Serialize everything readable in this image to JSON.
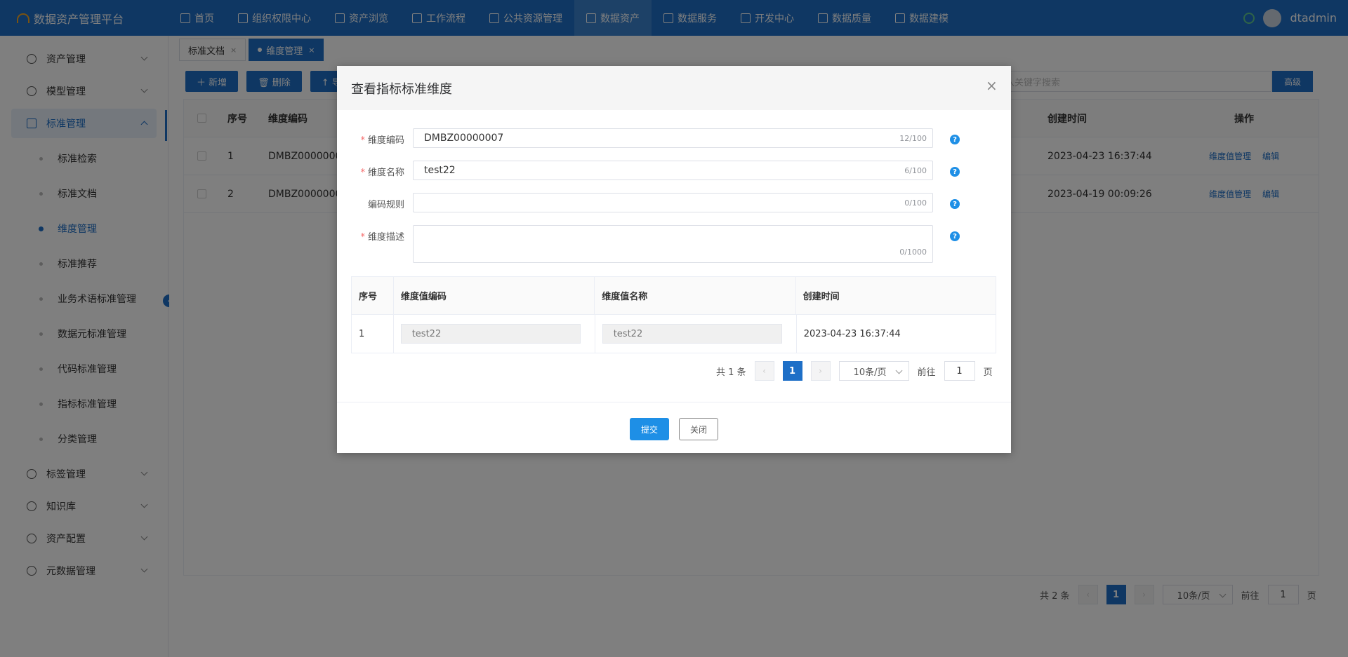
{
  "app": {
    "title": "数据资产管理平台"
  },
  "topnav": {
    "items": [
      {
        "label": "首页",
        "icon": "home-icon"
      },
      {
        "label": "组织权限中心",
        "icon": "shield-icon"
      },
      {
        "label": "资产浏览",
        "icon": "list-icon"
      },
      {
        "label": "工作流程",
        "icon": "workflow-icon"
      },
      {
        "label": "公共资源管理",
        "icon": "resource-icon"
      },
      {
        "label": "数据资产",
        "icon": "asset-icon"
      },
      {
        "label": "数据服务",
        "icon": "service-icon"
      },
      {
        "label": "开发中心",
        "icon": "edit-icon"
      },
      {
        "label": "数据质量",
        "icon": "chart-icon"
      },
      {
        "label": "数据建模",
        "icon": "layers-icon"
      }
    ],
    "active_index": 5,
    "user": "dtadmin"
  },
  "sidebar": {
    "groups_top": [
      {
        "label": "资产管理",
        "icon": "clock-icon"
      },
      {
        "label": "模型管理",
        "icon": "model-icon"
      },
      {
        "label": "标准管理",
        "icon": "document-icon"
      }
    ],
    "sub_items": [
      {
        "label": "标准检索"
      },
      {
        "label": "标准文档"
      },
      {
        "label": "维度管理"
      },
      {
        "label": "标准推荐"
      },
      {
        "label": "业务术语标准管理"
      },
      {
        "label": "数据元标准管理"
      },
      {
        "label": "代码标准管理"
      },
      {
        "label": "指标标准管理"
      },
      {
        "label": "分类管理"
      }
    ],
    "active_sub": 2,
    "groups_bottom": [
      {
        "label": "标签管理",
        "icon": "plus-circle-icon"
      },
      {
        "label": "知识库",
        "icon": "tag-icon"
      },
      {
        "label": "资产配置",
        "icon": "settings-icon"
      },
      {
        "label": "元数据管理",
        "icon": "database-icon"
      }
    ]
  },
  "tabs": [
    {
      "label": "标准文档",
      "active": false
    },
    {
      "label": "维度管理",
      "active": true
    }
  ],
  "toolbar": {
    "add": "＋ 新增",
    "delete": "🗑 删除",
    "import": "↑ 导"
  },
  "search": {
    "placeholder": "入关键字搜索",
    "advanced": "高级"
  },
  "table": {
    "headers": {
      "idx": "序号",
      "code": "维度编码",
      "time": "创建时间",
      "ops": "操作"
    },
    "rows": [
      {
        "idx": "1",
        "code": "DMBZ0000000",
        "time": "2023-04-23 16:37:44",
        "op1": "维度值管理",
        "op2": "编辑"
      },
      {
        "idx": "2",
        "code": "DMBZ0000000",
        "time": "2023-04-19 00:09:26",
        "op1": "维度值管理",
        "op2": "编辑"
      }
    ]
  },
  "pager": {
    "total": "共 2 条",
    "page": "1",
    "size": "10条/页",
    "goto": "前往",
    "goto_value": "1",
    "page_unit": "页"
  },
  "modal": {
    "title": "查看指标标准维度",
    "fields": [
      {
        "label": "维度编码",
        "required": true,
        "value": "DMBZ00000007",
        "count": "12/100"
      },
      {
        "label": "维度名称",
        "required": true,
        "value": "test22",
        "count": "6/100"
      },
      {
        "label": "编码规则",
        "required": false,
        "value": "",
        "count": "0/100"
      },
      {
        "label": "维度描述",
        "required": true,
        "value": "",
        "count": "0/1000"
      }
    ],
    "table": {
      "headers": [
        "序号",
        "维度值编码",
        "维度值名称",
        "创建时间"
      ],
      "rows": [
        {
          "idx": "1",
          "code": "test22",
          "name": "test22",
          "time": "2023-04-23 16:37:44"
        }
      ]
    },
    "pager": {
      "total": "共 1 条",
      "page": "1",
      "size": "10条/页",
      "goto": "前往",
      "goto_value": "1",
      "page_unit": "页"
    },
    "submit": "提交",
    "close": "关闭"
  }
}
